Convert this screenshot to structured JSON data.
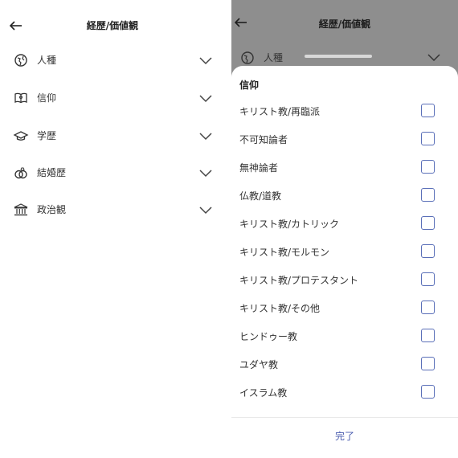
{
  "left": {
    "title": "経歴/価値観",
    "rows": [
      {
        "label": "人種",
        "icon": "globe-icon"
      },
      {
        "label": "信仰",
        "icon": "book-icon"
      },
      {
        "label": "学歴",
        "icon": "graduation-cap-icon"
      },
      {
        "label": "結婚歴",
        "icon": "rings-icon"
      },
      {
        "label": "政治観",
        "icon": "building-icon"
      }
    ]
  },
  "right": {
    "title": "経歴/価値観",
    "peek_row": {
      "label": "人種",
      "icon": "globe-icon"
    },
    "sheet": {
      "title": "信仰",
      "options": [
        {
          "label": "キリスト教/再臨派",
          "checked": false
        },
        {
          "label": "不可知論者",
          "checked": false
        },
        {
          "label": "無神論者",
          "checked": false
        },
        {
          "label": "仏教/道教",
          "checked": false
        },
        {
          "label": "キリスト教/カトリック",
          "checked": false
        },
        {
          "label": "キリスト教/モルモン",
          "checked": false
        },
        {
          "label": "キリスト教/プロテスタント",
          "checked": false
        },
        {
          "label": "キリスト教/その他",
          "checked": false
        },
        {
          "label": "ヒンドゥー教",
          "checked": false
        },
        {
          "label": "ユダヤ教",
          "checked": false
        },
        {
          "label": "イスラム教",
          "checked": false
        }
      ],
      "done_label": "完了"
    }
  },
  "colors": {
    "accent": "#4d5fb0",
    "checkbox_border": "#5a6fb8",
    "overlay": "#8e8e8e"
  }
}
